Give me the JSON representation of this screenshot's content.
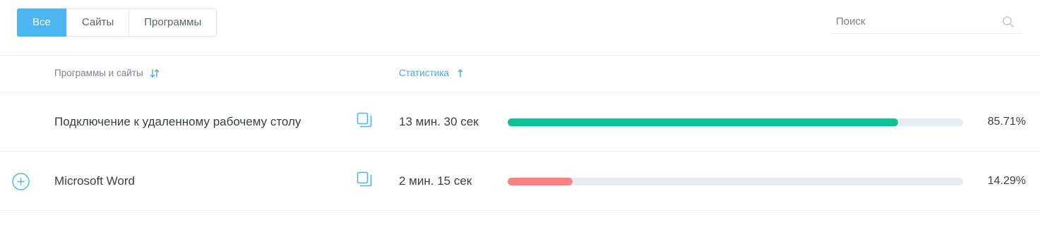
{
  "tabs": [
    {
      "label": "Все",
      "active": true
    },
    {
      "label": "Сайты",
      "active": false
    },
    {
      "label": "Программы",
      "active": false
    }
  ],
  "search": {
    "placeholder": "Поиск",
    "value": "",
    "icon": "search-icon"
  },
  "table": {
    "columns": {
      "programs": "Программы и сайты",
      "stats": "Статистика"
    },
    "rows": [
      {
        "name": "Подключение к удаленному рабочему столу",
        "duration": "13 мин. 30 сек",
        "percent": "85.71%",
        "share": 0.8571,
        "bar_color": "#12c093",
        "expandable": false
      },
      {
        "name": "Microsoft Word",
        "duration": "2 мин. 15 сек",
        "percent": "14.29%",
        "share": 0.1429,
        "bar_color": "#f98383",
        "expandable": true
      }
    ]
  },
  "colors": {
    "accent": "#4db5f0",
    "link": "#4aa8e0",
    "border": "#eceef0"
  }
}
